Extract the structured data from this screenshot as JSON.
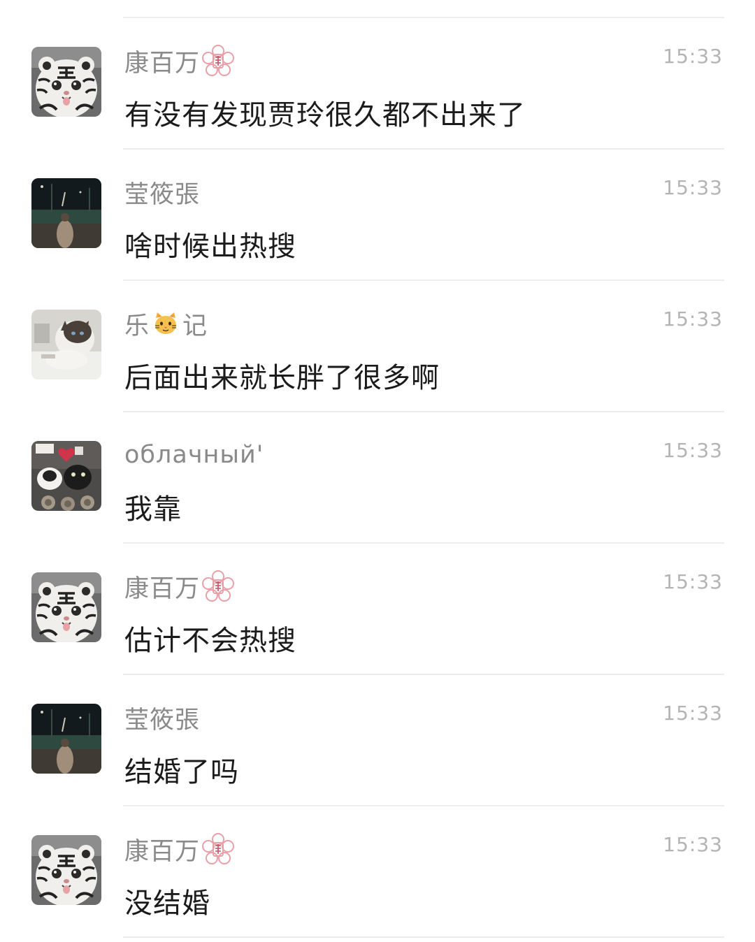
{
  "messages": [
    {
      "sender": "康百万",
      "time": "15:33",
      "text": "有没有发现贾玲很久都不出来了",
      "avatar": "tiger-cat",
      "badge": "flower-seal-icon"
    },
    {
      "sender": "莹筱張",
      "time": "15:33",
      "text": "啥时候出热搜",
      "avatar": "night-photo"
    },
    {
      "sender_parts": [
        "乐",
        "记"
      ],
      "sender_emoji": "cat-face-emoji",
      "time": "15:33",
      "text": "后面出来就长胖了很多啊",
      "avatar": "ragdoll-cat"
    },
    {
      "sender": "облачный'",
      "time": "15:33",
      "text": "我靠",
      "avatar": "cats-collage"
    },
    {
      "sender": "康百万",
      "time": "15:33",
      "text": "估计不会热搜",
      "avatar": "tiger-cat",
      "badge": "flower-seal-icon"
    },
    {
      "sender": "莹筱張",
      "time": "15:33",
      "text": "结婚了吗",
      "avatar": "night-photo"
    },
    {
      "sender": "康百万",
      "time": "15:33",
      "text": "没结婚",
      "avatar": "tiger-cat",
      "badge": "flower-seal-icon"
    }
  ],
  "colors": {
    "name": "#8a8a8a",
    "time": "#b4b4b4",
    "message": "#1b1b1b",
    "divider": "#ededed",
    "badge": "#e8a0a8"
  }
}
